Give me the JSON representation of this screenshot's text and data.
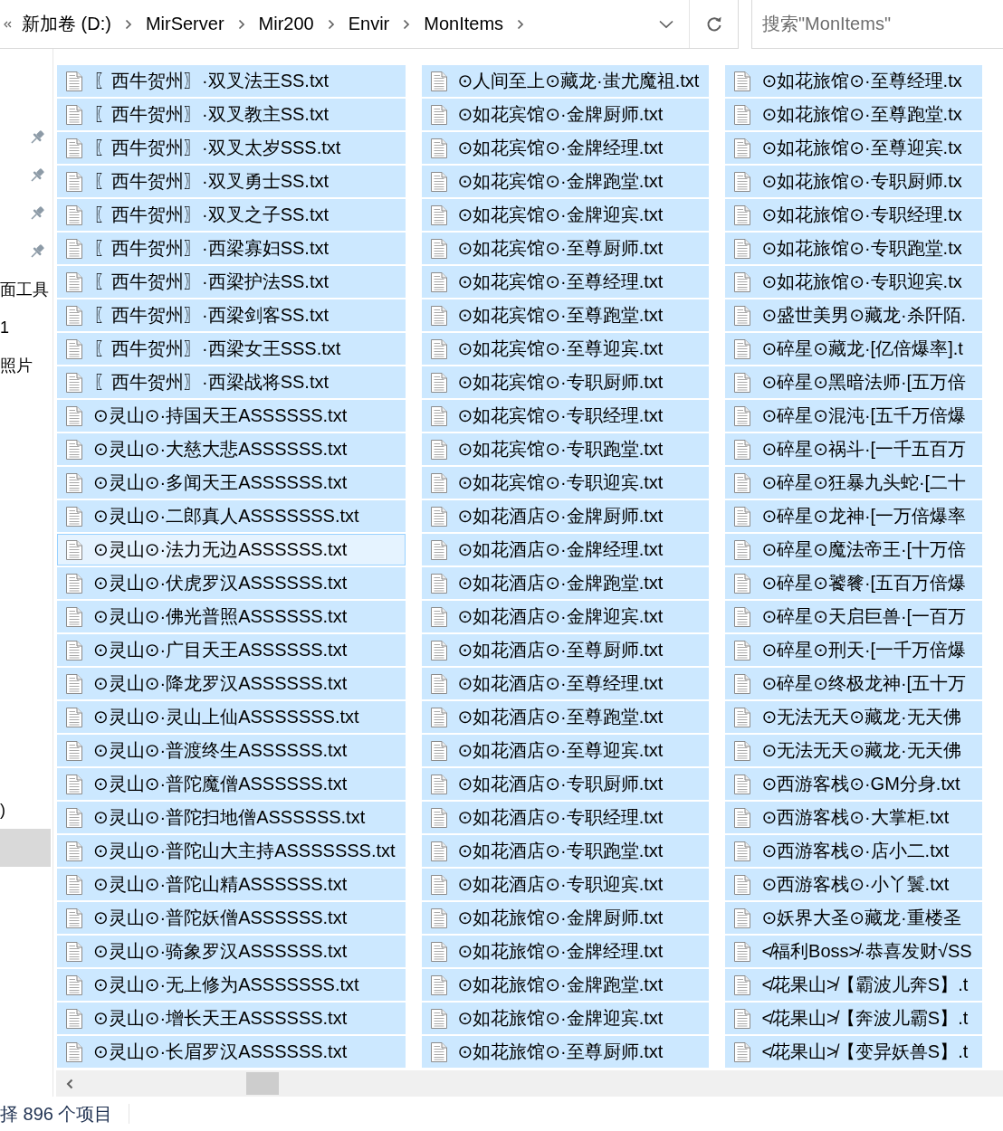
{
  "address_bar": {
    "breadcrumb": [
      "新加卷 (D:)",
      "MirServer",
      "Mir200",
      "Envir",
      "MonItems"
    ]
  },
  "search": {
    "placeholder": "搜索\"MonItems\""
  },
  "nav": {
    "items": [
      {
        "pinned": true,
        "selected": false
      },
      {
        "pinned": true,
        "selected": false
      },
      {
        "pinned": true,
        "selected": false
      },
      {
        "pinned": true,
        "selected": false
      },
      {
        "label": "面工具",
        "pinned": false,
        "selected": false
      },
      {
        "label": "1",
        "pinned": false,
        "selected": false
      },
      {
        "label": "照片",
        "pinned": false,
        "selected": false
      }
    ],
    "lower_items": [
      {
        "label": ")",
        "selected": false
      },
      {
        "selected": true
      }
    ]
  },
  "files": [
    {
      "name": "〖西牛贺州〗·双叉法王SS.txt",
      "selected": true,
      "focused": false
    },
    {
      "name": "〖西牛贺州〗·双叉教主SS.txt",
      "selected": true,
      "focused": false
    },
    {
      "name": "〖西牛贺州〗·双叉太岁SSS.txt",
      "selected": true,
      "focused": false
    },
    {
      "name": "〖西牛贺州〗·双叉勇士SS.txt",
      "selected": true,
      "focused": false
    },
    {
      "name": "〖西牛贺州〗·双叉之子SS.txt",
      "selected": true,
      "focused": false
    },
    {
      "name": "〖西牛贺州〗·西梁寡妇SS.txt",
      "selected": true,
      "focused": false
    },
    {
      "name": "〖西牛贺州〗·西梁护法SS.txt",
      "selected": true,
      "focused": false
    },
    {
      "name": "〖西牛贺州〗·西梁剑客SS.txt",
      "selected": true,
      "focused": false
    },
    {
      "name": "〖西牛贺州〗·西梁女王SSS.txt",
      "selected": true,
      "focused": false
    },
    {
      "name": "〖西牛贺州〗·西梁战将SS.txt",
      "selected": true,
      "focused": false
    },
    {
      "name": "⊙灵山⊙·持国天王ASSSSSS.txt",
      "selected": true,
      "focused": false
    },
    {
      "name": "⊙灵山⊙·大慈大悲ASSSSSS.txt",
      "selected": true,
      "focused": false
    },
    {
      "name": "⊙灵山⊙·多闻天王ASSSSSS.txt",
      "selected": true,
      "focused": false
    },
    {
      "name": "⊙灵山⊙·二郎真人ASSSSSSS.txt",
      "selected": true,
      "focused": false
    },
    {
      "name": "⊙灵山⊙·法力无边ASSSSSS.txt",
      "selected": true,
      "focused": true
    },
    {
      "name": "⊙灵山⊙·伏虎罗汉ASSSSSS.txt",
      "selected": true,
      "focused": false
    },
    {
      "name": "⊙灵山⊙·佛光普照ASSSSSS.txt",
      "selected": true,
      "focused": false
    },
    {
      "name": "⊙灵山⊙·广目天王ASSSSSS.txt",
      "selected": true,
      "focused": false
    },
    {
      "name": "⊙灵山⊙·降龙罗汉ASSSSSS.txt",
      "selected": true,
      "focused": false
    },
    {
      "name": "⊙灵山⊙·灵山上仙ASSSSSSS.txt",
      "selected": true,
      "focused": false
    },
    {
      "name": "⊙灵山⊙·普渡终生ASSSSSS.txt",
      "selected": true,
      "focused": false
    },
    {
      "name": "⊙灵山⊙·普陀魔僧ASSSSSS.txt",
      "selected": true,
      "focused": false
    },
    {
      "name": "⊙灵山⊙·普陀扫地僧ASSSSSS.txt",
      "selected": true,
      "focused": false
    },
    {
      "name": "⊙灵山⊙·普陀山大主持ASSSSSSS.txt",
      "selected": true,
      "focused": false
    },
    {
      "name": "⊙灵山⊙·普陀山精ASSSSSS.txt",
      "selected": true,
      "focused": false
    },
    {
      "name": "⊙灵山⊙·普陀妖僧ASSSSSS.txt",
      "selected": true,
      "focused": false
    },
    {
      "name": "⊙灵山⊙·骑象罗汉ASSSSSS.txt",
      "selected": true,
      "focused": false
    },
    {
      "name": "⊙灵山⊙·无上修为ASSSSSSS.txt",
      "selected": true,
      "focused": false
    },
    {
      "name": "⊙灵山⊙·增长天王ASSSSSS.txt",
      "selected": true,
      "focused": false
    },
    {
      "name": "⊙灵山⊙·长眉罗汉ASSSSSS.txt",
      "selected": true,
      "focused": false
    },
    {
      "name": "⊙人间至上⊙藏龙·蚩尤魔祖.txt",
      "selected": true,
      "focused": false
    },
    {
      "name": "⊙如花宾馆⊙·金牌厨师.txt",
      "selected": true,
      "focused": false
    },
    {
      "name": "⊙如花宾馆⊙·金牌经理.txt",
      "selected": true,
      "focused": false
    },
    {
      "name": "⊙如花宾馆⊙·金牌跑堂.txt",
      "selected": true,
      "focused": false
    },
    {
      "name": "⊙如花宾馆⊙·金牌迎宾.txt",
      "selected": true,
      "focused": false
    },
    {
      "name": "⊙如花宾馆⊙·至尊厨师.txt",
      "selected": true,
      "focused": false
    },
    {
      "name": "⊙如花宾馆⊙·至尊经理.txt",
      "selected": true,
      "focused": false
    },
    {
      "name": "⊙如花宾馆⊙·至尊跑堂.txt",
      "selected": true,
      "focused": false
    },
    {
      "name": "⊙如花宾馆⊙·至尊迎宾.txt",
      "selected": true,
      "focused": false
    },
    {
      "name": "⊙如花宾馆⊙·专职厨师.txt",
      "selected": true,
      "focused": false
    },
    {
      "name": "⊙如花宾馆⊙·专职经理.txt",
      "selected": true,
      "focused": false
    },
    {
      "name": "⊙如花宾馆⊙·专职跑堂.txt",
      "selected": true,
      "focused": false
    },
    {
      "name": "⊙如花宾馆⊙·专职迎宾.txt",
      "selected": true,
      "focused": false
    },
    {
      "name": "⊙如花酒店⊙·金牌厨师.txt",
      "selected": true,
      "focused": false
    },
    {
      "name": "⊙如花酒店⊙·金牌经理.txt",
      "selected": true,
      "focused": false
    },
    {
      "name": "⊙如花酒店⊙·金牌跑堂.txt",
      "selected": true,
      "focused": false
    },
    {
      "name": "⊙如花酒店⊙·金牌迎宾.txt",
      "selected": true,
      "focused": false
    },
    {
      "name": "⊙如花酒店⊙·至尊厨师.txt",
      "selected": true,
      "focused": false
    },
    {
      "name": "⊙如花酒店⊙·至尊经理.txt",
      "selected": true,
      "focused": false
    },
    {
      "name": "⊙如花酒店⊙·至尊跑堂.txt",
      "selected": true,
      "focused": false
    },
    {
      "name": "⊙如花酒店⊙·至尊迎宾.txt",
      "selected": true,
      "focused": false
    },
    {
      "name": "⊙如花酒店⊙·专职厨师.txt",
      "selected": true,
      "focused": false
    },
    {
      "name": "⊙如花酒店⊙·专职经理.txt",
      "selected": true,
      "focused": false
    },
    {
      "name": "⊙如花酒店⊙·专职跑堂.txt",
      "selected": true,
      "focused": false
    },
    {
      "name": "⊙如花酒店⊙·专职迎宾.txt",
      "selected": true,
      "focused": false
    },
    {
      "name": "⊙如花旅馆⊙·金牌厨师.txt",
      "selected": true,
      "focused": false
    },
    {
      "name": "⊙如花旅馆⊙·金牌经理.txt",
      "selected": true,
      "focused": false
    },
    {
      "name": "⊙如花旅馆⊙·金牌跑堂.txt",
      "selected": true,
      "focused": false
    },
    {
      "name": "⊙如花旅馆⊙·金牌迎宾.txt",
      "selected": true,
      "focused": false
    },
    {
      "name": "⊙如花旅馆⊙·至尊厨师.txt",
      "selected": true,
      "focused": false
    },
    {
      "name": "⊙如花旅馆⊙·至尊经理.tx",
      "selected": true,
      "focused": false
    },
    {
      "name": "⊙如花旅馆⊙·至尊跑堂.tx",
      "selected": true,
      "focused": false
    },
    {
      "name": "⊙如花旅馆⊙·至尊迎宾.tx",
      "selected": true,
      "focused": false
    },
    {
      "name": "⊙如花旅馆⊙·专职厨师.tx",
      "selected": true,
      "focused": false
    },
    {
      "name": "⊙如花旅馆⊙·专职经理.tx",
      "selected": true,
      "focused": false
    },
    {
      "name": "⊙如花旅馆⊙·专职跑堂.tx",
      "selected": true,
      "focused": false
    },
    {
      "name": "⊙如花旅馆⊙·专职迎宾.tx",
      "selected": true,
      "focused": false
    },
    {
      "name": "⊙盛世美男⊙藏龙·杀阡陌.",
      "selected": true,
      "focused": false
    },
    {
      "name": "⊙碎星⊙藏龙·[亿倍爆率].t",
      "selected": true,
      "focused": false
    },
    {
      "name": "⊙碎星⊙黑暗法师·[五万倍",
      "selected": true,
      "focused": false
    },
    {
      "name": "⊙碎星⊙混沌·[五千万倍爆",
      "selected": true,
      "focused": false
    },
    {
      "name": "⊙碎星⊙祸斗·[一千五百万",
      "selected": true,
      "focused": false
    },
    {
      "name": "⊙碎星⊙狂暴九头蛇·[二十",
      "selected": true,
      "focused": false
    },
    {
      "name": "⊙碎星⊙龙神·[一万倍爆率",
      "selected": true,
      "focused": false
    },
    {
      "name": "⊙碎星⊙魔法帝王·[十万倍",
      "selected": true,
      "focused": false
    },
    {
      "name": "⊙碎星⊙饕餮·[五百万倍爆",
      "selected": true,
      "focused": false
    },
    {
      "name": "⊙碎星⊙天启巨兽·[一百万",
      "selected": true,
      "focused": false
    },
    {
      "name": "⊙碎星⊙刑天·[一千万倍爆",
      "selected": true,
      "focused": false
    },
    {
      "name": "⊙碎星⊙终极龙神·[五十万",
      "selected": true,
      "focused": false
    },
    {
      "name": "⊙无法无天⊙藏龙·无天佛",
      "selected": true,
      "focused": false
    },
    {
      "name": "⊙无法无天⊙藏龙·无天佛",
      "selected": true,
      "focused": false
    },
    {
      "name": "⊙西游客栈⊙·GM分身.txt",
      "selected": true,
      "focused": false
    },
    {
      "name": "⊙西游客栈⊙·大掌柜.txt",
      "selected": true,
      "focused": false
    },
    {
      "name": "⊙西游客栈⊙·店小二.txt",
      "selected": true,
      "focused": false
    },
    {
      "name": "⊙西游客栈⊙·小丫鬟.txt",
      "selected": true,
      "focused": false
    },
    {
      "name": "⊙妖界大圣⊙藏龙·重楼圣",
      "selected": true,
      "focused": false
    },
    {
      "name": "≮福利Boss≯·恭喜发财√SS",
      "selected": true,
      "focused": false
    },
    {
      "name": "≮花果山≯【霸波儿奔S】.t",
      "selected": true,
      "focused": false
    },
    {
      "name": "≮花果山≯【奔波儿霸S】.t",
      "selected": true,
      "focused": false
    },
    {
      "name": "≮花果山≯【变异妖兽S】.t",
      "selected": true,
      "focused": false
    }
  ],
  "status_bar": {
    "text": "择 896 个项目"
  }
}
